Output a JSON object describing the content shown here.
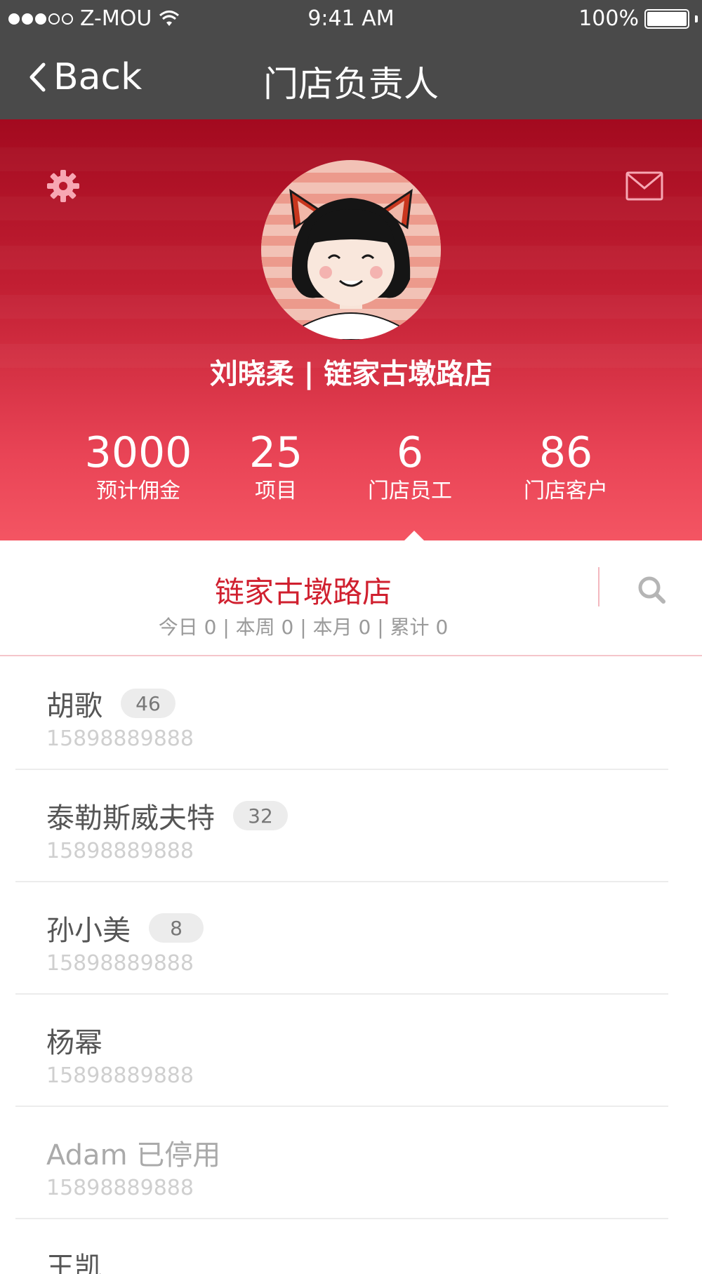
{
  "status_bar": {
    "carrier": "Z-MOU",
    "time": "9:41 AM",
    "battery": "100%",
    "signal_icon": "signal-dots-icon",
    "wifi_icon": "wifi-icon",
    "battery_icon": "battery-icon"
  },
  "nav": {
    "back_label": "Back",
    "title": "门店负责人"
  },
  "profile": {
    "line": "刘晓柔 | 链家古墩路店",
    "avatar_icon": "avatar-girl-cat-ears"
  },
  "stats": [
    {
      "value": "3000",
      "label": "预计佣金"
    },
    {
      "value": "25",
      "label": "项目"
    },
    {
      "value": "6",
      "label": "门店员工"
    },
    {
      "value": "86",
      "label": "门店客户"
    }
  ],
  "selected_stat": "门店员工",
  "store": {
    "name": "链家古墩路店",
    "stats_line": "今日 0 | 本周 0 | 本月 0 | 累计 0"
  },
  "employees": [
    {
      "name": "胡歌",
      "count": "46",
      "phone": "15898889888",
      "disabled": false
    },
    {
      "name": "泰勒斯威夫特",
      "count": "32",
      "phone": "15898889888",
      "disabled": false
    },
    {
      "name": "孙小美",
      "count": "8",
      "phone": "15898889888",
      "disabled": false
    },
    {
      "name": "杨幂",
      "count": "",
      "phone": "15898889888",
      "disabled": false
    },
    {
      "name": "Adam 已停用",
      "count": "",
      "phone": "15898889888",
      "disabled": true
    },
    {
      "name": "王凯",
      "count": "",
      "phone": "",
      "disabled": false
    }
  ],
  "colors": {
    "accent": "#d0202f",
    "nav_bg": "#4a4a4a",
    "hero_top": "#a30a1f",
    "hero_bottom": "#f45563"
  }
}
